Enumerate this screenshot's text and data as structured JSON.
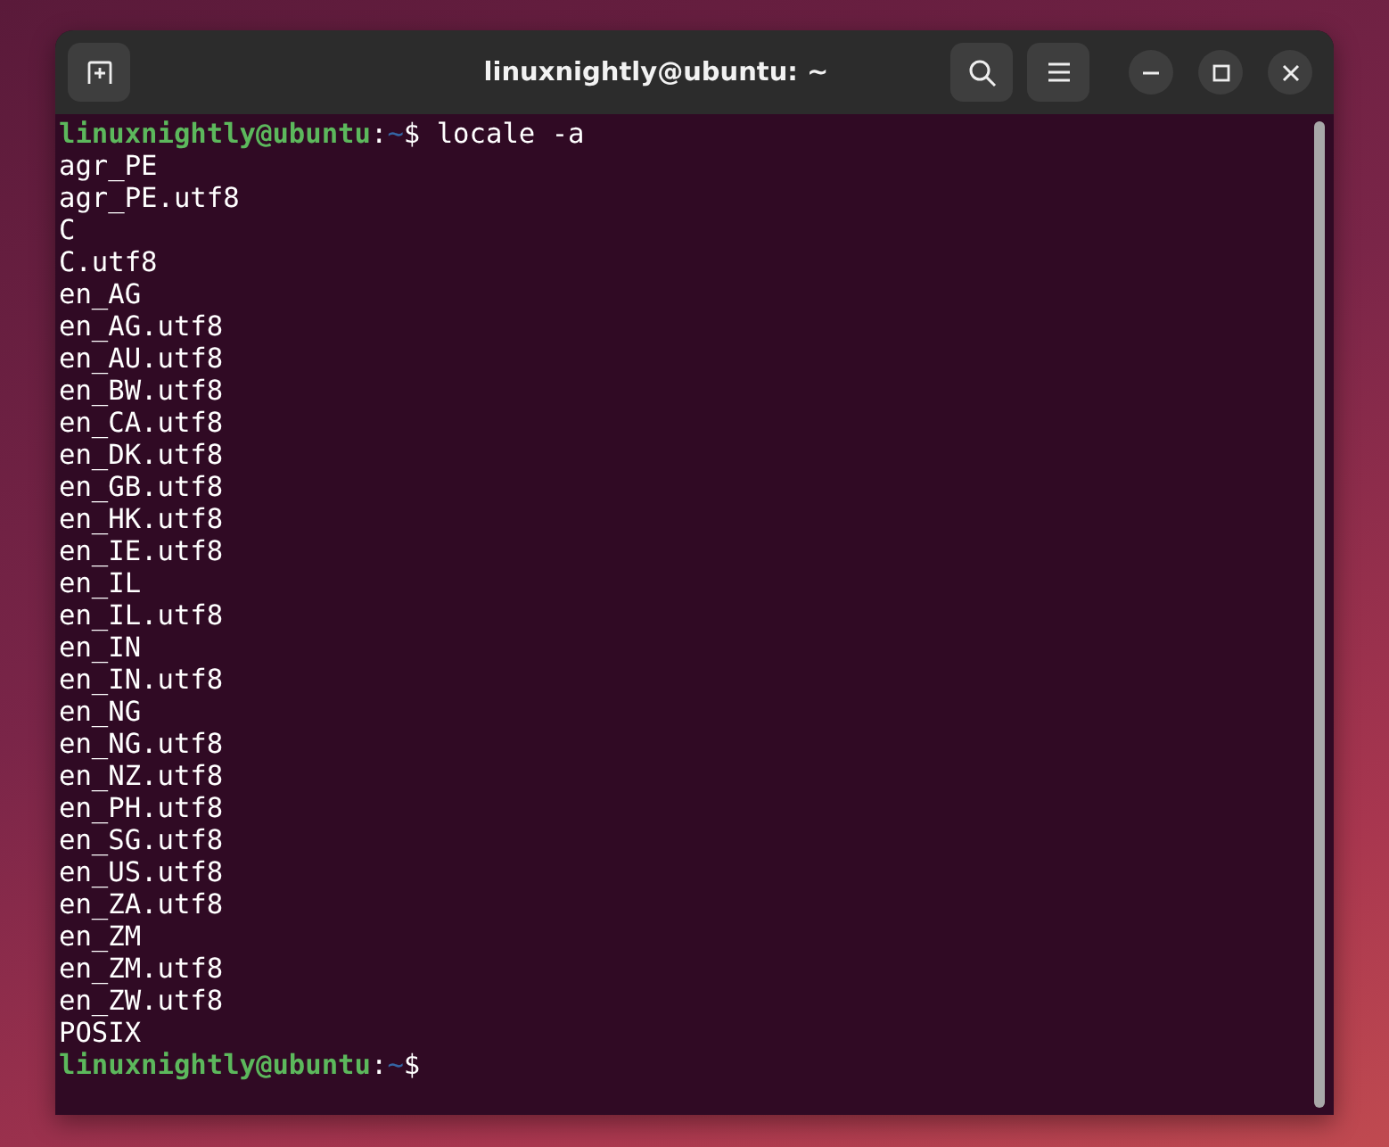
{
  "window": {
    "title": "linuxnightly@ubuntu: ~"
  },
  "terminal": {
    "lines": [
      {
        "kind": "prompt",
        "user": "linuxnightly@ubuntu",
        "separator": ":",
        "path": "~",
        "symbol": "$",
        "command": "locale -a"
      },
      {
        "kind": "output",
        "text": "agr_PE"
      },
      {
        "kind": "output",
        "text": "agr_PE.utf8"
      },
      {
        "kind": "output",
        "text": "C"
      },
      {
        "kind": "output",
        "text": "C.utf8"
      },
      {
        "kind": "output",
        "text": "en_AG"
      },
      {
        "kind": "output",
        "text": "en_AG.utf8"
      },
      {
        "kind": "output",
        "text": "en_AU.utf8"
      },
      {
        "kind": "output",
        "text": "en_BW.utf8"
      },
      {
        "kind": "output",
        "text": "en_CA.utf8"
      },
      {
        "kind": "output",
        "text": "en_DK.utf8"
      },
      {
        "kind": "output",
        "text": "en_GB.utf8"
      },
      {
        "kind": "output",
        "text": "en_HK.utf8"
      },
      {
        "kind": "output",
        "text": "en_IE.utf8"
      },
      {
        "kind": "output",
        "text": "en_IL"
      },
      {
        "kind": "output",
        "text": "en_IL.utf8"
      },
      {
        "kind": "output",
        "text": "en_IN"
      },
      {
        "kind": "output",
        "text": "en_IN.utf8"
      },
      {
        "kind": "output",
        "text": "en_NG"
      },
      {
        "kind": "output",
        "text": "en_NG.utf8"
      },
      {
        "kind": "output",
        "text": "en_NZ.utf8"
      },
      {
        "kind": "output",
        "text": "en_PH.utf8"
      },
      {
        "kind": "output",
        "text": "en_SG.utf8"
      },
      {
        "kind": "output",
        "text": "en_US.utf8"
      },
      {
        "kind": "output",
        "text": "en_ZA.utf8"
      },
      {
        "kind": "output",
        "text": "en_ZM"
      },
      {
        "kind": "output",
        "text": "en_ZM.utf8"
      },
      {
        "kind": "output",
        "text": "en_ZW.utf8"
      },
      {
        "kind": "output",
        "text": "POSIX"
      },
      {
        "kind": "prompt",
        "user": "linuxnightly@ubuntu",
        "separator": ":",
        "path": "~",
        "symbol": "$"
      }
    ]
  }
}
